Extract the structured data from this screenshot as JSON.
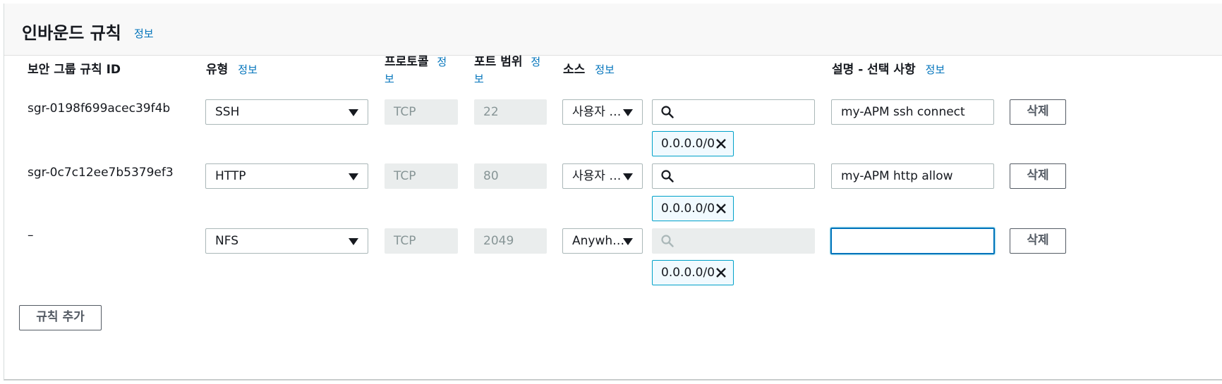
{
  "header": {
    "title": "인바운드 규칙",
    "info": "정보"
  },
  "columns": {
    "sgid": "보안 그룹 규칙 ID",
    "type": "유형",
    "protocol": "프로토콜",
    "port": "포트 범위",
    "source": "소스",
    "desc": "설명 - 선택 사항",
    "info": "정보",
    "info_a": "정",
    "info_b": "보"
  },
  "rules": [
    {
      "sgid": "sgr-0198f699acec39f4b",
      "type": "SSH",
      "protocol": "TCP",
      "port": "22",
      "source": "사용자 …",
      "source_token": "0.0.0.0/0",
      "description": "my-APM ssh connect",
      "delete": "삭제"
    },
    {
      "sgid": "sgr-0c7c12ee7b5379ef3",
      "type": "HTTP",
      "protocol": "TCP",
      "port": "80",
      "source": "사용자 …",
      "source_token": "0.0.0.0/0",
      "description": "my-APM http allow",
      "delete": "삭제"
    },
    {
      "sgid": "–",
      "type": "NFS",
      "protocol": "TCP",
      "port": "2049",
      "source": "Anywh…",
      "source_token": "0.0.0.0/0",
      "description": "",
      "delete": "삭제"
    }
  ],
  "add_rule": "규칙 추가",
  "colors": {
    "link": "#0073bb",
    "focus": "#0073bb",
    "token_border": "#00a1c9",
    "token_bg": "#f1faff",
    "disabled_bg": "#eaeded"
  },
  "icons": {
    "search": "search-icon",
    "caret": "caret-down-icon",
    "remove": "close-icon"
  }
}
